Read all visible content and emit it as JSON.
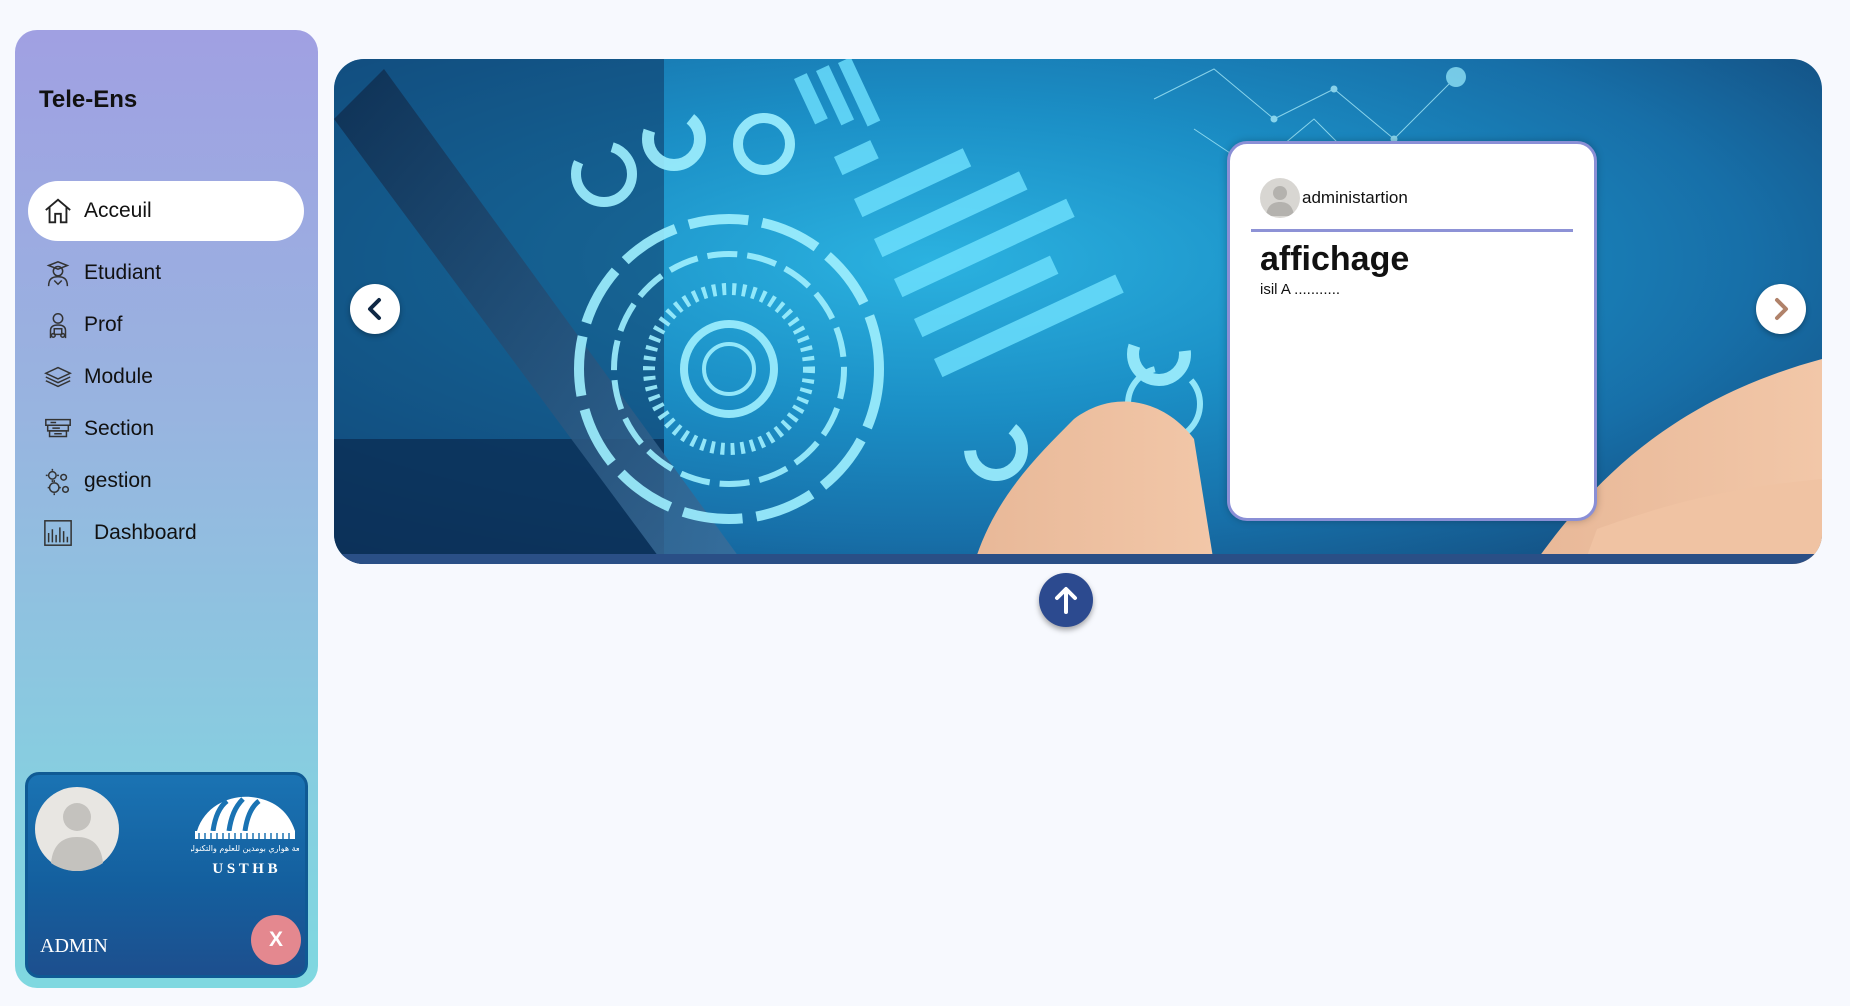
{
  "app": {
    "title": "Tele-Ens"
  },
  "sidebar": {
    "items": [
      {
        "label": "Acceuil",
        "icon": "home-icon",
        "active": true
      },
      {
        "label": "Etudiant",
        "icon": "student-icon"
      },
      {
        "label": "Prof",
        "icon": "teacher-icon"
      },
      {
        "label": "Module",
        "icon": "layers-icon"
      },
      {
        "label": "Section",
        "icon": "section-icon"
      },
      {
        "label": "gestion",
        "icon": "gears-icon"
      },
      {
        "label": "Dashboard",
        "icon": "chart-icon"
      }
    ]
  },
  "profile": {
    "role": "ADMIN",
    "close_label": "X",
    "logo_text": "U S T H B",
    "logo_arabic": "جامعة هواري بومدين للعلوم والتكنولوجيا"
  },
  "carousel": {
    "post": {
      "author": "administartion",
      "title": "affichage",
      "text": "isil A ..........."
    }
  },
  "colors": {
    "sidebar_top": "#a0a0e2",
    "sidebar_bottom": "#7fd8e0",
    "card_border": "#8a8fd6",
    "profile_bg": "#1a73b3",
    "close_btn": "#e4888f",
    "scroll_btn": "#2c4a8f"
  },
  "icons": {
    "prev": "chevron-left-icon",
    "next": "chevron-right-icon",
    "scroll_top": "arrow-up-icon"
  }
}
